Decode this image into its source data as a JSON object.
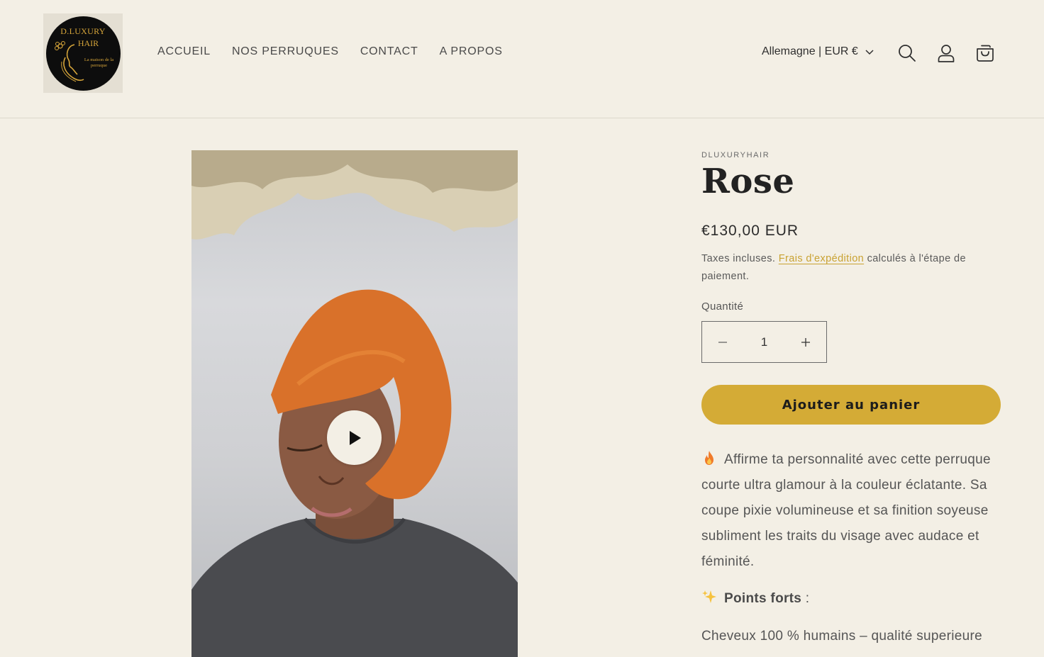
{
  "brand": {
    "logo_line1": "D.LUXURY",
    "logo_line2": "HAIR",
    "logo_tagline": "La maison de la perruque"
  },
  "nav": {
    "items": [
      {
        "label": "ACCUEIL"
      },
      {
        "label": "NOS PERRUQUES"
      },
      {
        "label": "CONTACT"
      },
      {
        "label": "A PROPOS"
      }
    ]
  },
  "header": {
    "country_selector": "Allemagne | EUR €",
    "icons": [
      "search-icon",
      "account-icon",
      "cart-icon"
    ]
  },
  "product": {
    "vendor": "DLUXURYHAIR",
    "title": "Rose",
    "price": "€130,00 EUR",
    "tax_prefix": "Taxes incluses. ",
    "shipping_link": "Frais d'expédition",
    "tax_suffix": " calculés à l'étape de paiement.",
    "quantity_label": "Quantité",
    "quantity_value": "1",
    "add_to_cart": "Ajouter au panier",
    "description": "Affirme ta personnalité avec cette perruque courte ultra glamour à la couleur éclatante. Sa coupe pixie volumineuse et sa finition soyeuse subliment les traits du visage avec audace et féminité.",
    "highlights_title": "Points forts",
    "highlights_suffix": " :",
    "highlight_1": "Cheveux 100 % humains – qualité superieure"
  },
  "colors": {
    "background": "#f3efe5",
    "accent": "#d4ab36",
    "link": "#c9a232"
  }
}
